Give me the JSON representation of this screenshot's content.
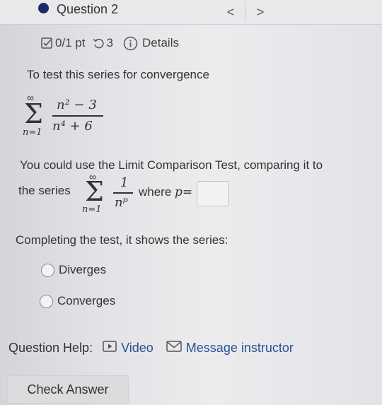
{
  "header": {
    "question_title": "Question 2",
    "prev_glyph": "<",
    "next_glyph": ">"
  },
  "meta": {
    "points": "0/1 pt",
    "attempts": "3",
    "details_label": "Details",
    "icons": [
      "checkbox-icon",
      "retry-icon",
      "info-icon"
    ]
  },
  "problem": {
    "intro": "To test this series for convergence",
    "series": {
      "sum_upper": "∞",
      "sum_lower": "n=1",
      "numerator": "n² − 3",
      "denominator": "n⁴ + 6"
    },
    "comparison_text": "You could use the Limit Comparison Test, comparing it to",
    "the_series_label": "the series",
    "comparison_series": {
      "sum_upper": "∞",
      "sum_lower": "n=1",
      "numerator": "1",
      "denominator": "nᵖ"
    },
    "where_text": "where",
    "p_label": "p=",
    "p_value": "",
    "completing_text": "Completing the test, it shows the series:",
    "options": [
      "Diverges",
      "Converges"
    ]
  },
  "help": {
    "label": "Question Help:",
    "video_label": "Video",
    "message_label": "Message instructor"
  },
  "check_answer_label": "Check Answer",
  "colors": {
    "accent_dot": "#1b2a66",
    "link": "#2c4f93"
  }
}
